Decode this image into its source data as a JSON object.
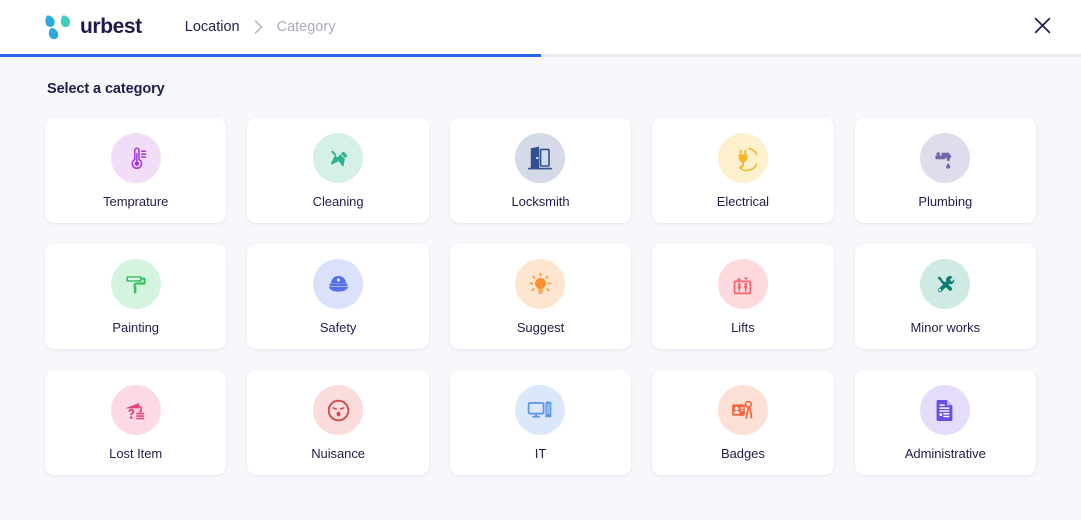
{
  "header": {
    "brand_name": "urbest",
    "logo_colors": {
      "blue": "#29a9e0",
      "teal": "#3fd0b8"
    },
    "breadcrumb": [
      {
        "label": "Location",
        "active": true
      },
      {
        "label": "Category",
        "active": false
      }
    ],
    "separator_icon": "chevron-right-icon",
    "close_icon": "close-icon"
  },
  "progress": {
    "percent": 50,
    "fill_color": "#2563eb",
    "track_color": "#e9eaf0"
  },
  "main": {
    "section_title": "Select a category",
    "categories": [
      {
        "label": "Temprature",
        "icon": "thermometer-icon",
        "bg": "#f2ddf8",
        "fg": "#a638d8"
      },
      {
        "label": "Cleaning",
        "icon": "broom-icon",
        "bg": "#d5f0e7",
        "fg": "#2fae92"
      },
      {
        "label": "Locksmith",
        "icon": "door-icon",
        "bg": "#d4dae8",
        "fg": "#32508f"
      },
      {
        "label": "Electrical",
        "icon": "plug-icon",
        "bg": "#fdf0cd",
        "fg": "#f5b325"
      },
      {
        "label": "Plumbing",
        "icon": "faucet-icon",
        "bg": "#dfdceb",
        "fg": "#6f65a8"
      },
      {
        "label": "Painting",
        "icon": "paint-roller-icon",
        "bg": "#d4f3de",
        "fg": "#2fc45f"
      },
      {
        "label": "Safety",
        "icon": "police-cap-icon",
        "bg": "#dbe0fb",
        "fg": "#5470e8"
      },
      {
        "label": "Suggest",
        "icon": "lightbulb-icon",
        "bg": "#fde5cf",
        "fg": "#fa8f30"
      },
      {
        "label": "Lifts",
        "icon": "elevator-icon",
        "bg": "#fcdadd",
        "fg": "#f5636e"
      },
      {
        "label": "Minor works",
        "icon": "hammer-wrench-icon",
        "bg": "#cfeae4",
        "fg": "#0c7c72"
      },
      {
        "label": "Lost Item",
        "icon": "umbrella-question-icon",
        "bg": "#fbdae6",
        "fg": "#e0457e"
      },
      {
        "label": "Nuisance",
        "icon": "angry-face-icon",
        "bg": "#fbdcdc",
        "fg": "#d24545"
      },
      {
        "label": "IT",
        "icon": "monitor-phone-icon",
        "bg": "#dbe8fa",
        "fg": "#5a93e8"
      },
      {
        "label": "Badges",
        "icon": "id-badge-keys-icon",
        "bg": "#fcdfd5",
        "fg": "#f2653a"
      },
      {
        "label": "Administrative",
        "icon": "document-icon",
        "bg": "#e4dcfa",
        "fg": "#6d4ee0"
      }
    ]
  }
}
